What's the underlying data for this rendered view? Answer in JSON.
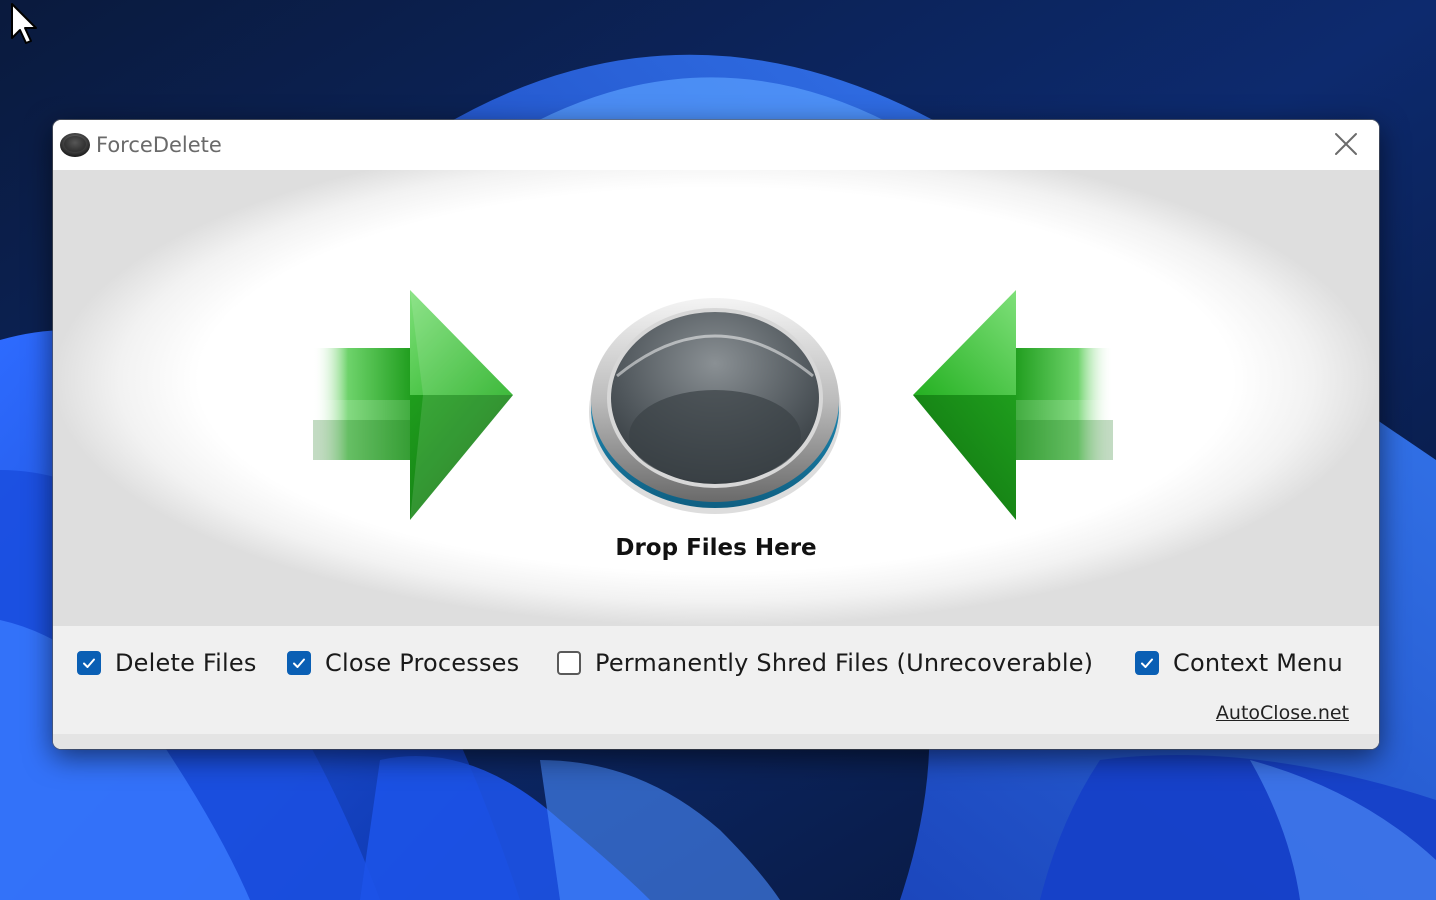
{
  "window": {
    "title": "ForceDelete",
    "icon": "app-disc-icon",
    "close_icon": "close-icon"
  },
  "drop_zone": {
    "label": "Drop Files Here",
    "left_arrow_icon": "green-arrow-right-icon",
    "right_arrow_icon": "green-arrow-left-icon",
    "center_icon": "bin-drop-icon"
  },
  "options": [
    {
      "label": "Delete Files",
      "checked": true
    },
    {
      "label": "Close Processes",
      "checked": true
    },
    {
      "label": "Permanently Shred Files (Unrecoverable)",
      "checked": false
    },
    {
      "label": "Context Menu",
      "checked": true
    }
  ],
  "link": {
    "text": "AutoClose.net"
  },
  "colors": {
    "checkbox_accent": "#0a5fb4",
    "arrow_green": "#22a51f",
    "wallpaper_blue": "#1a4fd8"
  }
}
